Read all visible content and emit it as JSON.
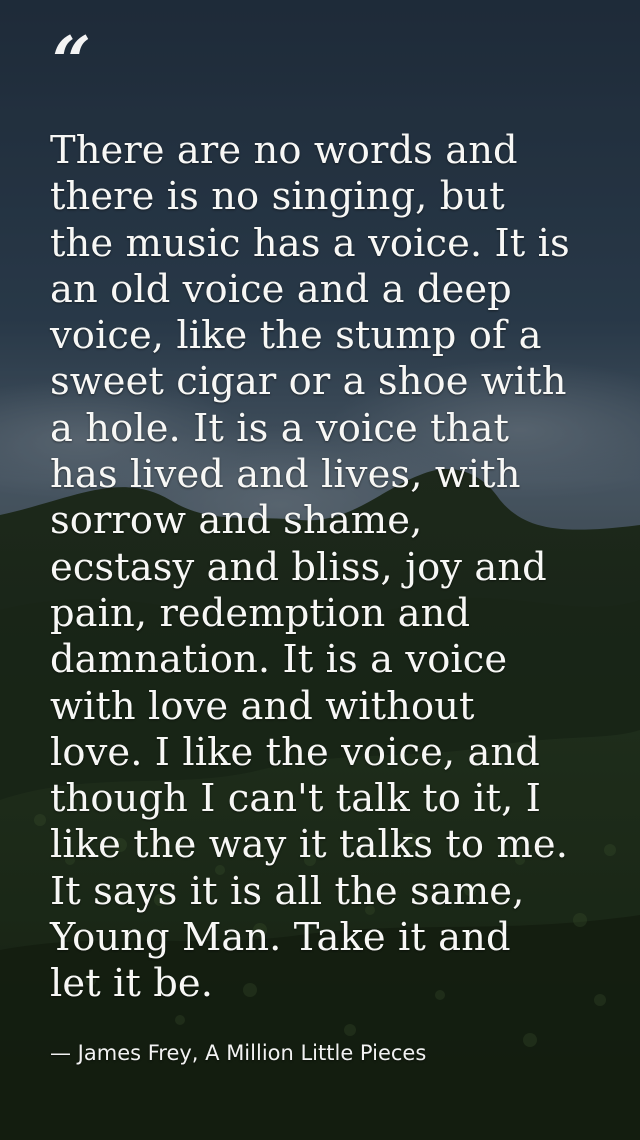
{
  "quote": {
    "mark": "“",
    "lines": [
      "There are no words and",
      "there is no singing, but",
      "the music has a voice. It is",
      "an old voice and a deep",
      "voice, like the stump of a",
      "sweet cigar or a shoe with",
      "a hole. It is a voice that",
      "has lived and lives, with",
      "sorrow and shame,",
      "ecstasy and bliss, joy and",
      "pain, redemption and",
      "damnation. It is a voice",
      "with love and without",
      "love. I like the voice, and",
      "though I can't talk to it, I",
      "like the way it talks to me.",
      "It says it is all the same,",
      "Young Man. Take it and",
      "let it be."
    ],
    "attribution": "— James Frey, A Million Little Pieces"
  },
  "colors": {
    "text": "#f7f7f5",
    "attribution": "#f2f2f2",
    "sky_top": "#2a3a4c",
    "sky_mid": "#55677a",
    "hill": "#1b2916"
  }
}
